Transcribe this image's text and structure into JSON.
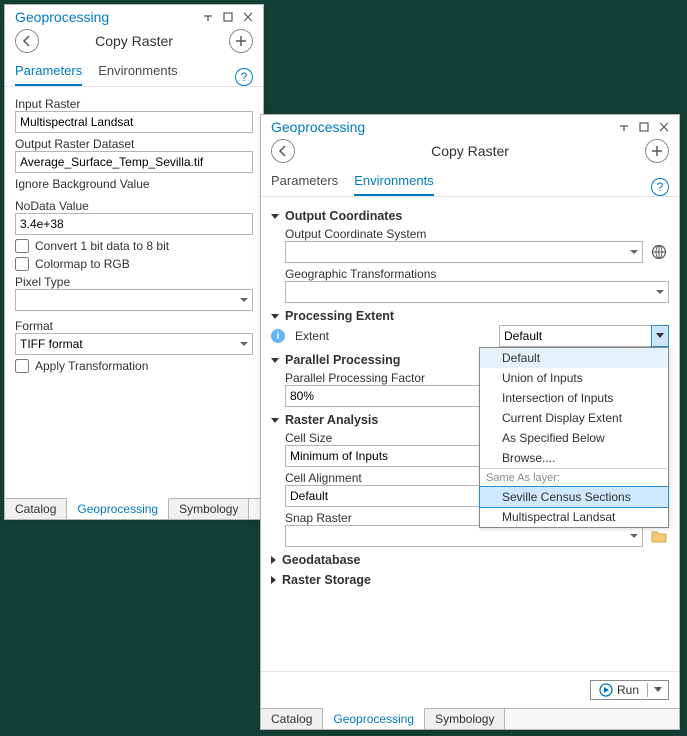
{
  "left": {
    "title": "Geoprocessing",
    "tool_title": "Copy Raster",
    "tabs": {
      "parameters": "Parameters",
      "environments": "Environments"
    },
    "active_tab": "parameters",
    "labels": {
      "input_raster": "Input Raster",
      "output_raster": "Output Raster Dataset",
      "ignore_bg": "Ignore Background Value",
      "nodata": "NoData Value",
      "convert_1bit": "Convert 1 bit data to 8 bit",
      "colormap": "Colormap to RGB",
      "pixel_type": "Pixel Type",
      "format": "Format",
      "apply_transform": "Apply Transformation"
    },
    "values": {
      "input_raster": "Multispectral Landsat",
      "output_raster": "Average_Surface_Temp_Sevilla.tif",
      "ignore_bg": "",
      "nodata": "3.4e+38",
      "pixel_type": "",
      "format": "TIFF format",
      "convert_1bit": false,
      "colormap": false,
      "apply_transform": false
    },
    "bottom_tabs": [
      "Catalog",
      "Geoprocessing",
      "Symbology"
    ],
    "bottom_active": "Geoprocessing"
  },
  "right": {
    "title": "Geoprocessing",
    "tool_title": "Copy Raster",
    "tabs": {
      "parameters": "Parameters",
      "environments": "Environments"
    },
    "active_tab": "environments",
    "sections": {
      "output_coordinates": {
        "title": "Output Coordinates",
        "open": true,
        "ocs_label": "Output Coordinate System",
        "ocs_value": "",
        "gt_label": "Geographic Transformations",
        "gt_value": ""
      },
      "processing_extent": {
        "title": "Processing Extent",
        "open": true,
        "extent_label": "Extent",
        "extent_value": "Default",
        "dropdown": {
          "options": [
            "Default",
            "Union of Inputs",
            "Intersection of Inputs",
            "Current Display Extent",
            "As Specified Below",
            "Browse...."
          ],
          "group_label": "Same As layer:",
          "layers": [
            "Seville Census Sections",
            "Multispectral Landsat"
          ],
          "highlight": "Seville Census Sections",
          "hover": "Default"
        }
      },
      "parallel": {
        "title": "Parallel Processing",
        "open": true,
        "pf_label": "Parallel Processing Factor",
        "pf_value": "80%"
      },
      "raster_analysis": {
        "title": "Raster Analysis",
        "open": true,
        "cellsize_label": "Cell Size",
        "cellsize_value": "Minimum of Inputs",
        "cellalign_label": "Cell Alignment",
        "cellalign_value": "Default",
        "snap_label": "Snap Raster",
        "snap_value": ""
      },
      "geodatabase": {
        "title": "Geodatabase",
        "open": false
      },
      "raster_storage": {
        "title": "Raster Storage",
        "open": false
      }
    },
    "run_label": "Run",
    "bottom_tabs": [
      "Catalog",
      "Geoprocessing",
      "Symbology"
    ],
    "bottom_active": "Geoprocessing"
  }
}
